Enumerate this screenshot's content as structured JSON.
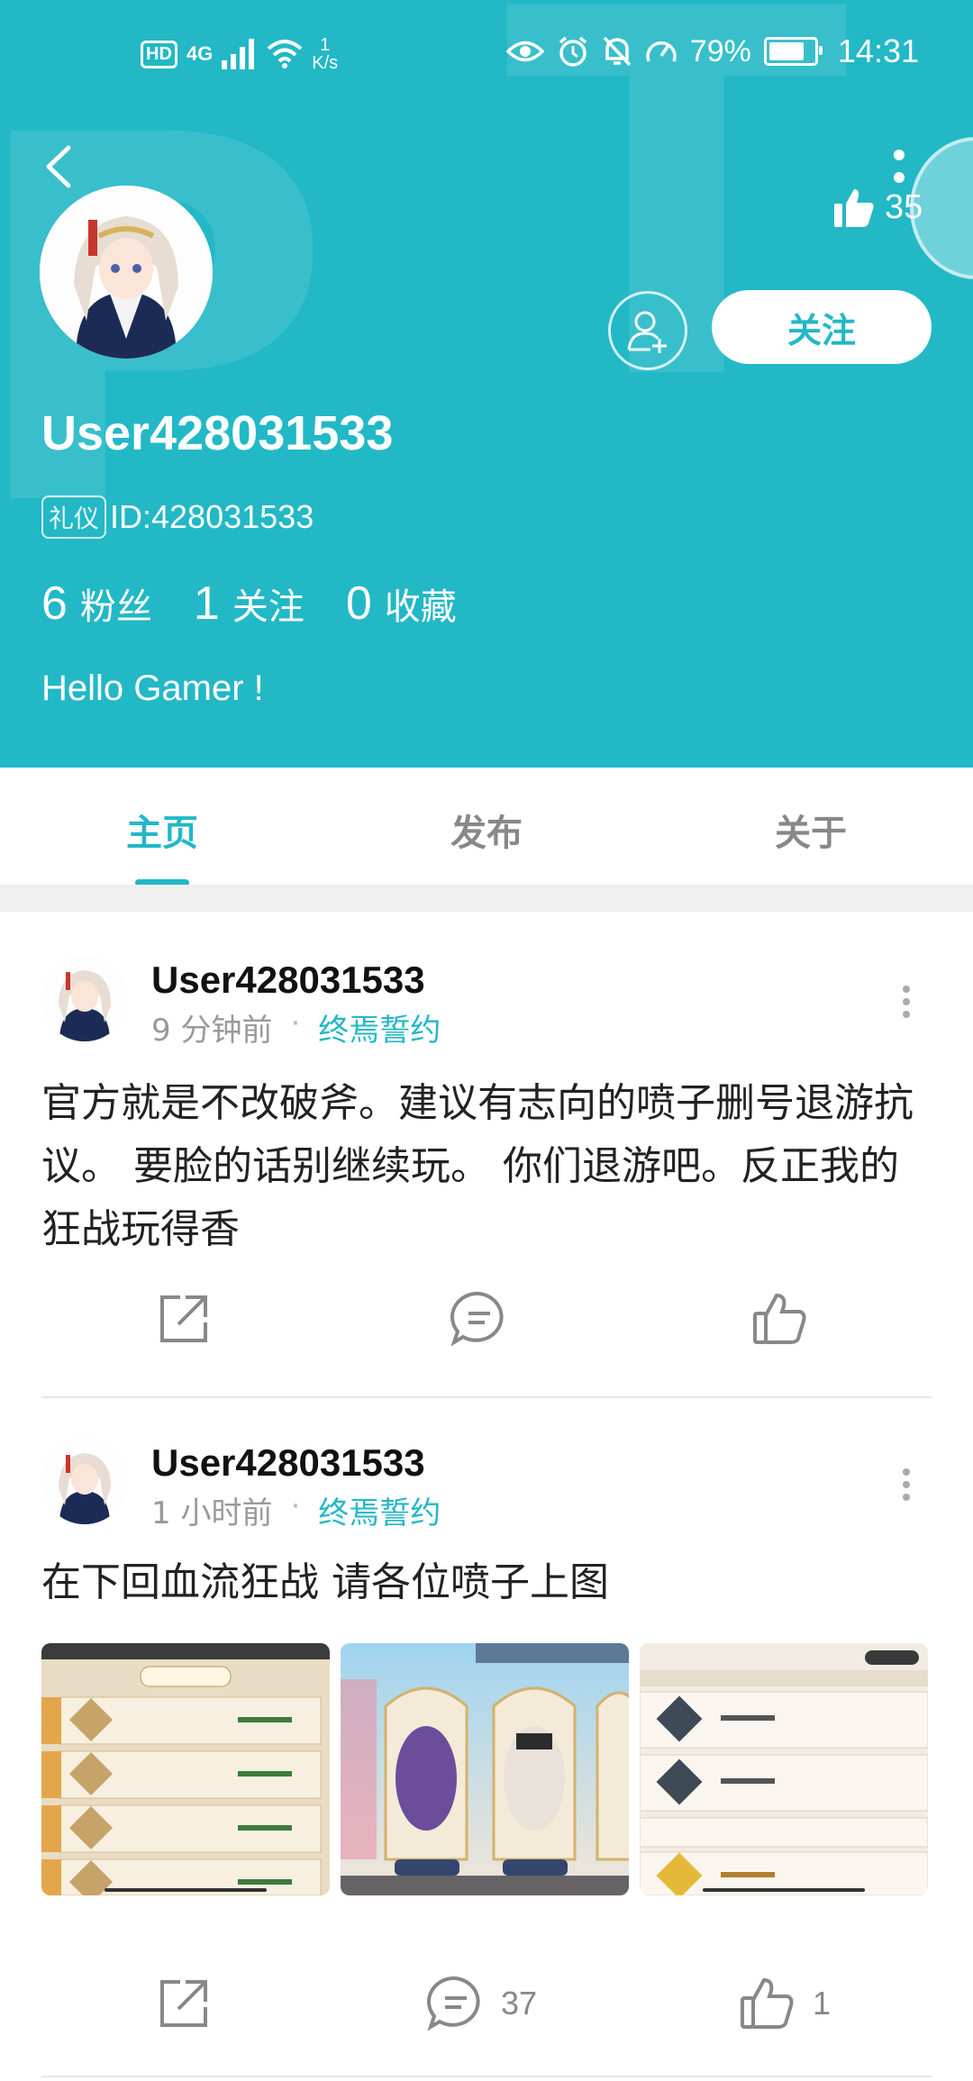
{
  "status_bar": {
    "hd": "HD",
    "network": "4G",
    "speed_value": "1",
    "speed_unit": "K/s",
    "battery_percent": "79%",
    "battery_level": 0.79,
    "time": "14:31"
  },
  "header": {
    "like_count": "35",
    "follow_label": "关注",
    "username": "User428031533",
    "id_tag": "礼仪",
    "id_text": "ID:428031533",
    "bio": "Hello Gamer !",
    "stats": [
      {
        "number": "6",
        "label": "粉丝"
      },
      {
        "number": "1",
        "label": "关注"
      },
      {
        "number": "0",
        "label": "收藏"
      }
    ],
    "bg_color": "#22b8c6"
  },
  "tabs": [
    {
      "label": "主页",
      "active": true
    },
    {
      "label": "发布",
      "active": false
    },
    {
      "label": "关于",
      "active": false
    }
  ],
  "posts": [
    {
      "user": "User428031533",
      "time": "9 分钟前",
      "topic": "终焉誓约",
      "text": "官方就是不改破斧。建议有志向的喷子删号退游抗议。 要脸的话别继续玩。 你们退游吧。反正我的狂战玩得香",
      "comment_count": "",
      "like_count": ""
    },
    {
      "user": "User428031533",
      "time": "1 小时前",
      "topic": "终焉誓约",
      "text": "在下回血流狂战 请各位喷子上图",
      "comment_count": "37",
      "like_count": "1"
    }
  ]
}
